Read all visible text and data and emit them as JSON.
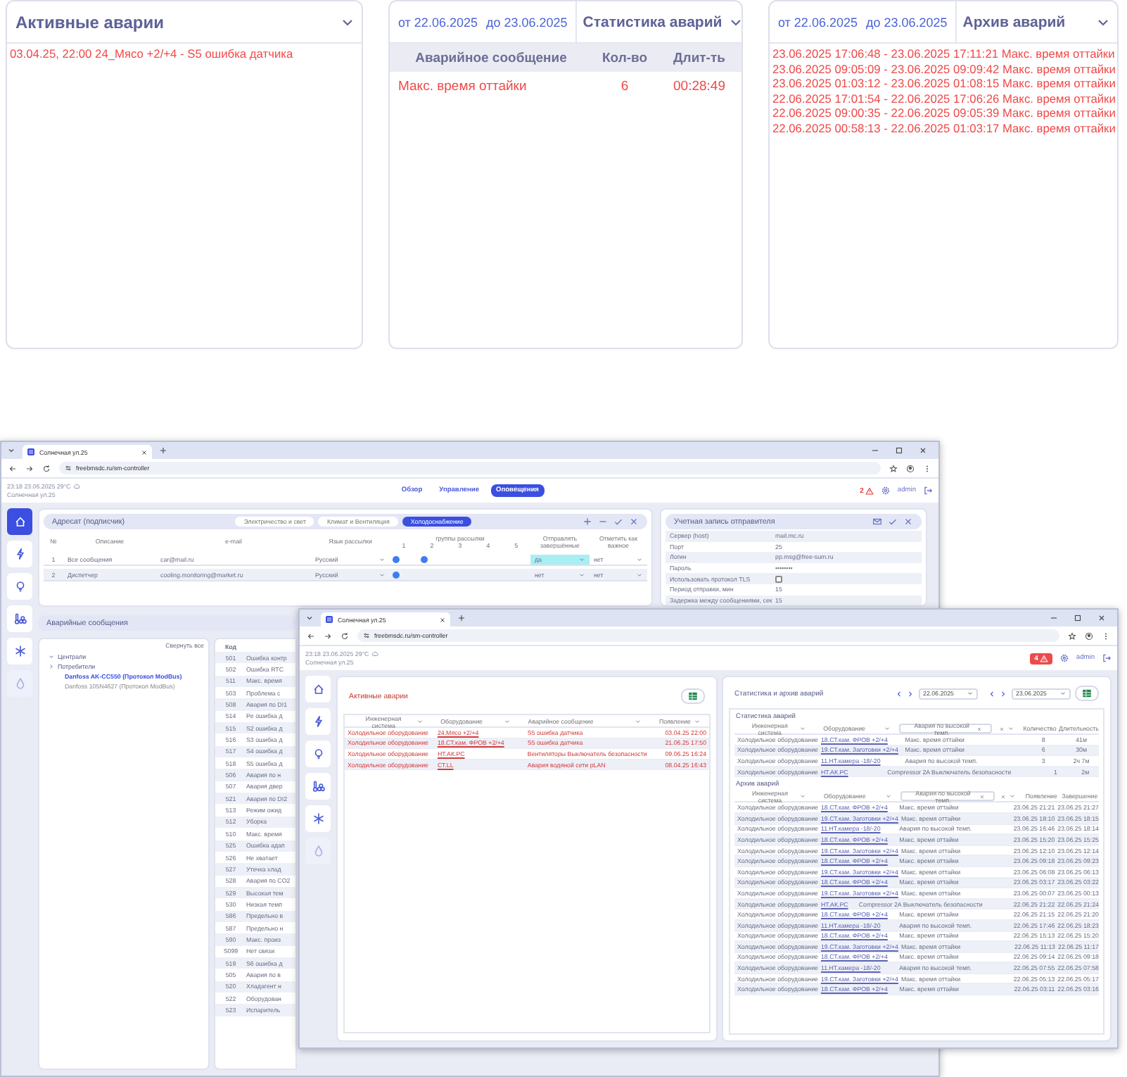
{
  "top_panels": [
    {
      "kind": "active",
      "title": "Активные аварии",
      "items": [
        "03.04.25, 22:00  24_Мясо +2/+4 - S5 ошибка датчика"
      ]
    },
    {
      "kind": "stats",
      "date_from": "от 22.06.2025",
      "date_to": "до 23.06.2025",
      "title": "Статистика аварий",
      "columns": [
        "Аварийное сообщение",
        "Кол-во",
        "Длит-ть"
      ],
      "rows": [
        [
          "Макс. время оттайки",
          "6",
          "00:28:49"
        ]
      ]
    },
    {
      "kind": "archive",
      "date_from": "от 22.06.2025",
      "date_to": "до 23.06.2025",
      "title": "Архив аварий",
      "items": [
        "23.06.2025 17:06:48 - 23.06.2025 17:11:21 Макс. время оттайки",
        "23.06.2025 09:05:09 - 23.06.2025 09:09:42 Макс. время оттайки",
        "23.06.2025 01:03:12 - 23.06.2025 01:08:15 Макс. время оттайки",
        "22.06.2025 17:01:54 - 22.06.2025 17:06:26 Макс. время оттайки",
        "22.06.2025 09:00:35 - 22.06.2025 09:05:39 Макс. время оттайки",
        "22.06.2025 00:58:13 - 22.06.2025 01:03:17 Макс. время оттайки"
      ]
    }
  ],
  "windows": [
    {
      "kind": "notifications",
      "tab_title": "Солнечная ул.25",
      "url": "freebmsdc.ru/sm-controller",
      "datetime": "23:18  23.06.2025  29°C",
      "location": "Солнечная ул.25",
      "nav": [
        {
          "label": "Обзор",
          "selected": false
        },
        {
          "label": "Управление",
          "selected": false
        },
        {
          "label": "Оповещения",
          "selected": true
        }
      ],
      "alarm_count": "2",
      "user": "admin",
      "sidebar": [
        {
          "kind": "home",
          "selected": true,
          "disabled": false
        },
        {
          "kind": "power",
          "selected": false,
          "disabled": false
        },
        {
          "kind": "light",
          "selected": false,
          "disabled": false
        },
        {
          "kind": "climate",
          "selected": false,
          "disabled": false
        },
        {
          "kind": "cooling",
          "selected": false,
          "disabled": false
        },
        {
          "kind": "water",
          "selected": false,
          "disabled": true
        }
      ],
      "subscribers": {
        "title": "Адресат (подписчик)",
        "groups": [
          {
            "label": "Электричество и свет",
            "selected": false
          },
          {
            "label": "Климат и Вентиляция",
            "selected": false
          },
          {
            "label": "Холодоснабжение",
            "selected": true
          }
        ],
        "columns": [
          "№",
          "Описание",
          "e-mail",
          "Язык рассылки",
          "группы рассылки",
          "Отправлять завершённые",
          "Отметить как важное"
        ],
        "group_numbers": [
          "1",
          "2",
          "3",
          "4",
          "5"
        ],
        "rows": [
          {
            "number": "1",
            "description": "Все сообщения",
            "email": "car@mail.ru",
            "language": "Русский",
            "groups": [
              true,
              true,
              false,
              false,
              false
            ],
            "send_completed": "да",
            "focused": true,
            "mark_important": "нет"
          },
          {
            "number": "2",
            "description": "Диспетчер",
            "email": "cooling.monitoring@market.ru",
            "language": "Русский",
            "groups": [
              true,
              false,
              false,
              false,
              false
            ],
            "send_completed": "нет",
            "focused": false,
            "mark_important": "нет"
          }
        ]
      },
      "sender": {
        "title": "Учетная запись отправителя",
        "fields": [
          {
            "kind": "text",
            "label": "Сервер (host)",
            "value": "mail.mc.ru"
          },
          {
            "kind": "text",
            "label": "Порт",
            "value": "25"
          },
          {
            "kind": "text",
            "label": "Логин",
            "value": "pp.msg@free-sum.ru"
          },
          {
            "kind": "text",
            "label": "Пароль",
            "value": "••••••••"
          },
          {
            "kind": "checkbox",
            "label": "Использовать протокол TLS",
            "checked": false
          },
          {
            "kind": "text",
            "label": "Период отправки, мин",
            "value": "15"
          },
          {
            "kind": "text",
            "label": "Задержка между сообщениями, сек",
            "value": "15"
          }
        ]
      },
      "alarm_messages": {
        "title": "Аварийные сообщения",
        "collapse_all": "Свернуть все",
        "tree": [
          {
            "label": "Централи",
            "expanded": true
          },
          {
            "label": "Потребители",
            "expanded": false
          }
        ],
        "devices": [
          {
            "label": "Danfoss AK-CC550 (Протокол ModBus)",
            "selected": true
          },
          {
            "label": "Danfoss 105N4627 (Протокол ModBus)",
            "selected": false
          }
        ],
        "code_header": "Код",
        "codes": [
          [
            "501",
            "Ошибка контр"
          ],
          [
            "502",
            "Ошибка RTC"
          ],
          [
            "511",
            "Макс. время"
          ],
          [
            "503",
            "Проблема с"
          ],
          [
            "508",
            "Авария по DI1"
          ],
          [
            "514",
            "Pe ошибка д"
          ],
          [
            "515",
            "S2 ошибка д"
          ],
          [
            "516",
            "S3 ошибка д"
          ],
          [
            "517",
            "S4 ошибка д"
          ],
          [
            "518",
            "S5 ошибка д"
          ],
          [
            "506",
            "Авария по н"
          ],
          [
            "507",
            "Авария двер"
          ],
          [
            "521",
            "Авария по DI2"
          ],
          [
            "513",
            "Режим ожид"
          ],
          [
            "512",
            "Уборка"
          ],
          [
            "510",
            "Макс. время"
          ],
          [
            "525",
            "Ошибка адап"
          ],
          [
            "526",
            "Не хватает"
          ],
          [
            "527",
            "Утечка хлад"
          ],
          [
            "528",
            "Авария по CO2"
          ],
          [
            "529",
            "Высокая тем"
          ],
          [
            "530",
            "Низкая темп"
          ],
          [
            "586",
            "Предельно в"
          ],
          [
            "587",
            "Предельно н"
          ],
          [
            "590",
            "Макс. произ"
          ],
          [
            "S099",
            "Нет связи"
          ],
          [
            "519",
            "S6 ошибка д"
          ],
          [
            "505",
            "Авария по в"
          ],
          [
            "520",
            "Хладагент н"
          ],
          [
            "522",
            "Оборудован"
          ],
          [
            "523",
            "Испаритель"
          ]
        ]
      }
    },
    {
      "kind": "alarms",
      "tab_title": "Солнечная ул.25",
      "url": "freebmsdc.ru/sm-controller",
      "datetime": "23:18  23.06.2025  29°C",
      "location": "Солнечная ул.25",
      "alarm_count": "4",
      "user": "admin",
      "sidebar": [
        {
          "kind": "home",
          "selected": false,
          "disabled": false
        },
        {
          "kind": "power",
          "selected": false,
          "disabled": false
        },
        {
          "kind": "light",
          "selected": false,
          "disabled": false
        },
        {
          "kind": "climate",
          "selected": false,
          "disabled": false
        },
        {
          "kind": "cooling",
          "selected": false,
          "disabled": false
        },
        {
          "kind": "water",
          "selected": false,
          "disabled": true
        }
      ],
      "active": {
        "title": "Активные аварии",
        "columns": [
          "Инженерная система",
          "Оборудование",
          "Аварийное сообщение",
          "Появление"
        ],
        "rows": [
          [
            "Холодильное оборудование",
            "24.Мясо +2/+4",
            "S5 ошибка датчика",
            "03.04.25 22:00"
          ],
          [
            "Холодильное оборудование",
            "18.СТ.кам. ФРОВ +2/+4",
            "S5 ошибка датчика",
            "21.06.25 17:50"
          ],
          [
            "Холодильное оборудование",
            "НТ.АК.РС",
            "Вентиляторы Выключатель безопасности",
            "09.06.25 16:24"
          ],
          [
            "Холодильное оборудование",
            "СТ.LL",
            "Авария водяной сети pLAN",
            "08.04.25 16:43"
          ]
        ]
      },
      "history": {
        "title": "Статистика и архив аварий",
        "date_from": "22.06.2025",
        "date_to": "23.06.2025",
        "stats_title": "Статистика аварий",
        "stats_columns": [
          "Инженерная система",
          "Оборудование",
          "Авария по высокой темп.",
          "Количество",
          "Длительность"
        ],
        "stats_rows": [
          [
            "Холодильное оборудование",
            "18.СТ.кам. ФРОВ +2/+4",
            "Макс. время оттайки",
            "8",
            "41м"
          ],
          [
            "Холодильное оборудование",
            "19.СТ.кам. Заготовки +2/+4",
            "Макс. время оттайки",
            "6",
            "30м"
          ],
          [
            "Холодильное оборудование",
            "11.НТ.камера -18/-20",
            "Авария по высокой темп.",
            "3",
            "2ч 7м"
          ],
          [
            "Холодильное оборудование",
            "НТ.АК.РС",
            "Compressor 2A Выключатель безопасности",
            "1",
            "2м"
          ]
        ],
        "archive_title": "Архив аварий",
        "archive_columns": [
          "Инженерная система",
          "Оборудование",
          "Авария по высокой темп.",
          "Появление",
          "Завершение"
        ],
        "archive_rows": [
          [
            "Холодильное оборудование",
            "18.СТ.кам. ФРОВ +2/+4",
            "Макс. время оттайки",
            "23.06.25 21:21",
            "23.06.25 21:27"
          ],
          [
            "Холодильное оборудование",
            "19.СТ.кам. Заготовки +2/+4",
            "Макс. время оттайки",
            "23.06.25 18:10",
            "23.06.25 18:15"
          ],
          [
            "Холодильное оборудование",
            "11.НТ.камера -18/-20",
            "Авария по высокой темп.",
            "23.06.25 16:46",
            "23.06.25 18:14"
          ],
          [
            "Холодильное оборудование",
            "18.СТ.кам. ФРОВ +2/+4",
            "Макс. время оттайки",
            "23.06.25 15:20",
            "23.06.25 15:25"
          ],
          [
            "Холодильное оборудование",
            "19.СТ.кам. Заготовки +2/+4",
            "Макс. время оттайки",
            "23.06.25 12:10",
            "23.06.25 12:14"
          ],
          [
            "Холодильное оборудование",
            "18.СТ.кам. ФРОВ +2/+4",
            "Макс. время оттайки",
            "23.06.25 09:18",
            "23.06.25 09:23"
          ],
          [
            "Холодильное оборудование",
            "19.СТ.кам. Заготовки +2/+4",
            "Макс. время оттайки",
            "23.06.25 06:08",
            "23.06.25 06:13"
          ],
          [
            "Холодильное оборудование",
            "18.СТ.кам. ФРОВ +2/+4",
            "Макс. время оттайки",
            "23.06.25 03:17",
            "23.06.25 03:22"
          ],
          [
            "Холодильное оборудование",
            "19.СТ.кам. Заготовки +2/+4",
            "Макс. время оттайки",
            "23.06.25 00:07",
            "23.06.25 00:13"
          ],
          [
            "Холодильное оборудование",
            "НТ.АК.РС",
            "Compressor 2A Выключатель безопасности",
            "22.06.25 21:22",
            "22.06.25 21:24"
          ],
          [
            "Холодильное оборудование",
            "18.СТ.кам. ФРОВ +2/+4",
            "Макс. время оттайки",
            "22.06.25 21:15",
            "22.06.25 21:20"
          ],
          [
            "Холодильное оборудование",
            "11.НТ.камера -18/-20",
            "Авария по высокой темп.",
            "22.06.25 17:46",
            "22.06.25 18:23"
          ],
          [
            "Холодильное оборудование",
            "18.СТ.кам. ФРОВ +2/+4",
            "Макс. время оттайки",
            "22.06.25 15:13",
            "22.06.25 15:20"
          ],
          [
            "Холодильное оборудование",
            "19.СТ.кам. Заготовки +2/+4",
            "Макс. время оттайки",
            "22.06.25 11:13",
            "22.06.25 11:17"
          ],
          [
            "Холодильное оборудование",
            "18.СТ.кам. ФРОВ +2/+4",
            "Макс. время оттайки",
            "22.06.25 09:14",
            "22.06.25 09:18"
          ],
          [
            "Холодильное оборудование",
            "11.НТ.камера -18/-20",
            "Авария по высокой темп.",
            "22.06.25 07:55",
            "22.06.25 07:58"
          ],
          [
            "Холодильное оборудование",
            "19.СТ.кам. Заготовки +2/+4",
            "Макс. время оттайки",
            "22.06.25 05:13",
            "22.06.25 05:17"
          ],
          [
            "Холодильное оборудование",
            "18.СТ.кам. ФРОВ +2/+4",
            "Макс. время оттайки",
            "22.06.25 03:11",
            "22.06.25 03:16"
          ]
        ]
      }
    }
  ]
}
